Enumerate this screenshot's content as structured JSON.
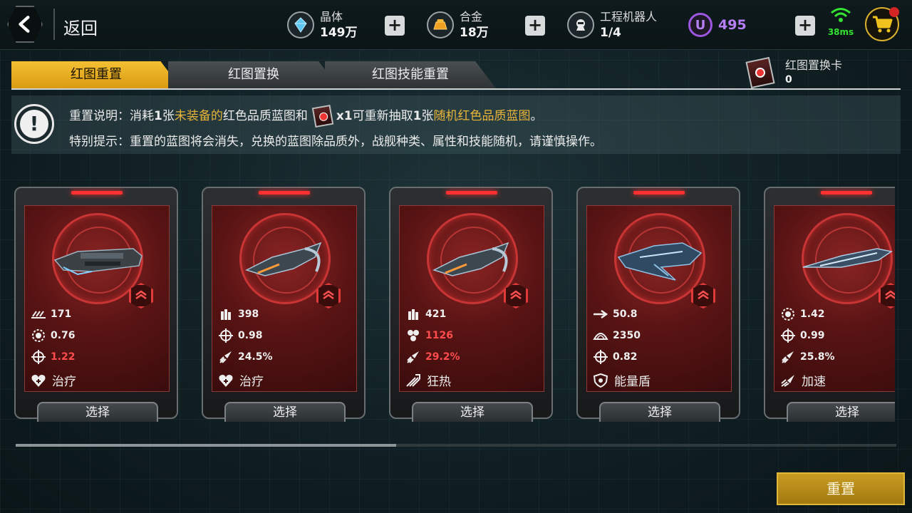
{
  "topbar": {
    "back_label": "返回",
    "resources": [
      {
        "name": "晶体",
        "value": "149万",
        "icon": "crystal-icon"
      },
      {
        "name": "合金",
        "value": "18万",
        "icon": "alloy-icon"
      },
      {
        "name": "工程机器人",
        "value": "1/4",
        "icon": "robot-icon"
      }
    ],
    "premium_value": "495",
    "premium_icon_letter": "U",
    "ping": "38ms"
  },
  "tabs": [
    {
      "label": "红图重置",
      "active": true
    },
    {
      "label": "红图置换",
      "active": false
    },
    {
      "label": "红图技能重置",
      "active": false
    }
  ],
  "card_count": {
    "label": "红图置换卡",
    "value": "0"
  },
  "notice": {
    "line1_prefix": "重置说明：消耗",
    "line1_num1": "1",
    "line1_zhang": "张",
    "line1_highlight1": "未装备的",
    "line1_mid": "红色品质蓝图和",
    "line1_x": "x1",
    "line1_after": "可重新抽取",
    "line1_num2": "1",
    "line1_zhang2": "张",
    "line1_highlight2": "随机红色品质蓝图",
    "line1_end": "。",
    "line2": "特别提示：重置的蓝图将会消失，兑换的蓝图除品质外，战舰种类、属性和技能随机，请谨慎操作。"
  },
  "ships": [
    {
      "stats": [
        {
          "icon": "missile-salvo-icon",
          "value": "171",
          "red": false
        },
        {
          "icon": "gear-icon",
          "value": "0.76",
          "red": false
        },
        {
          "icon": "crosshair-icon",
          "value": "1.22",
          "red": true
        }
      ],
      "skill": {
        "icon": "heal-icon",
        "label": "治疗"
      },
      "select": "选择"
    },
    {
      "stats": [
        {
          "icon": "ammo-icon",
          "value": "398",
          "red": false
        },
        {
          "icon": "crosshair-icon",
          "value": "0.98",
          "red": false
        },
        {
          "icon": "rocket-icon",
          "value": "24.5%",
          "red": false
        }
      ],
      "skill": {
        "icon": "heal-icon",
        "label": "治疗"
      },
      "select": "选择"
    },
    {
      "stats": [
        {
          "icon": "ammo-icon",
          "value": "421",
          "red": false
        },
        {
          "icon": "hex-cluster-icon",
          "value": "1126",
          "red": true
        },
        {
          "icon": "rocket-icon",
          "value": "29.2%",
          "red": true
        }
      ],
      "skill": {
        "icon": "frenzy-icon",
        "label": "狂热"
      },
      "select": "选择"
    },
    {
      "stats": [
        {
          "icon": "arrow-icon",
          "value": "50.8",
          "red": false
        },
        {
          "icon": "armor-icon",
          "value": "2350",
          "red": false
        },
        {
          "icon": "crosshair-icon",
          "value": "0.82",
          "red": false
        }
      ],
      "skill": {
        "icon": "shield-icon",
        "label": "能量盾"
      },
      "select": "选择"
    },
    {
      "stats": [
        {
          "icon": "gear-icon",
          "value": "1.42",
          "red": false
        },
        {
          "icon": "crosshair-icon",
          "value": "0.99",
          "red": false
        },
        {
          "icon": "rocket-icon",
          "value": "25.8%",
          "red": false
        }
      ],
      "skill": {
        "icon": "speed-icon",
        "label": "加速"
      },
      "select": "选择"
    }
  ],
  "reset_button": "重置",
  "colors": {
    "accent": "#d99b12",
    "stat_red": "#ff4c4c",
    "premium": "#b67ef5",
    "ping": "#33e233"
  }
}
